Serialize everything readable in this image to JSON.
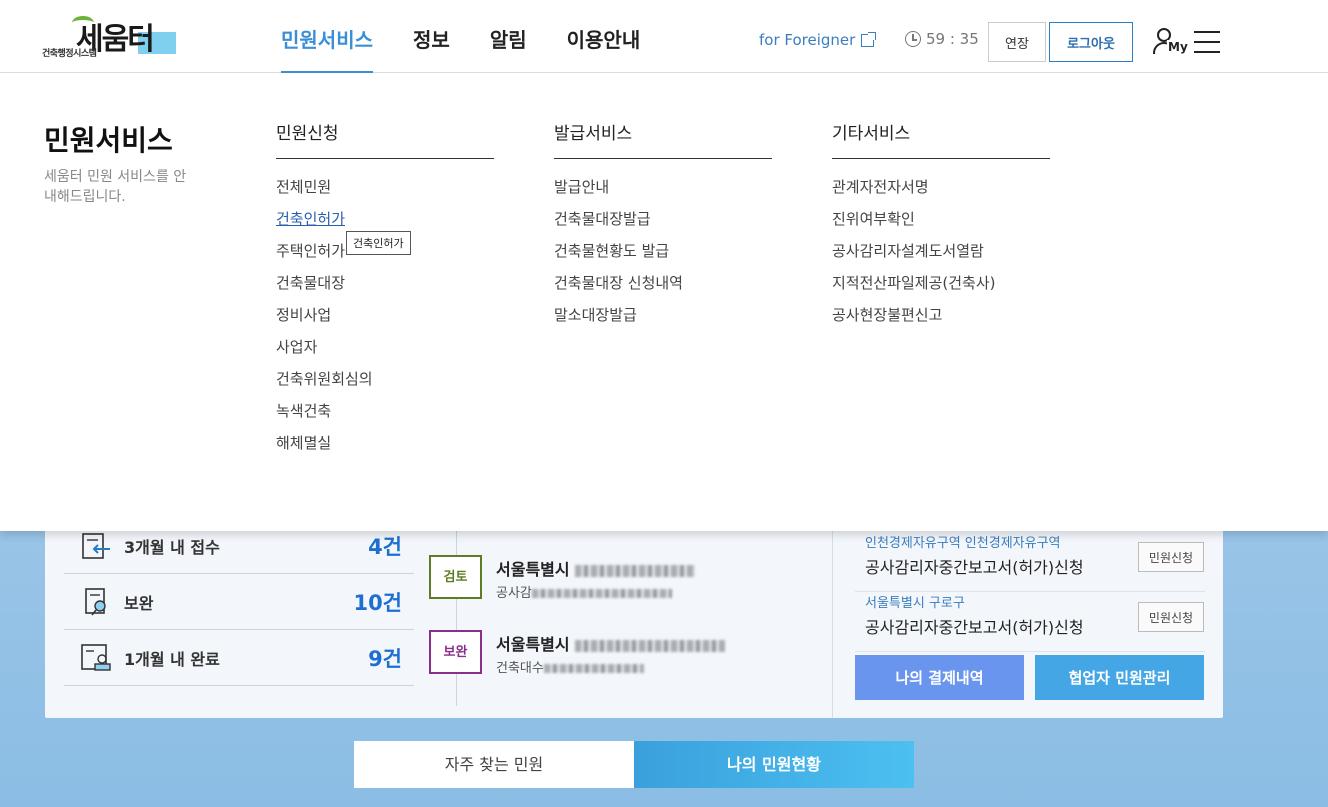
{
  "header": {
    "logo_main": "세움터",
    "logo_sub": "건축행정시스템",
    "nav": [
      "민원서비스",
      "정보",
      "알림",
      "이용안내"
    ],
    "foreigner_link": "for Foreigner",
    "timer": "59 : 35",
    "extend_label": "연장",
    "logout_label": "로그아웃",
    "my_label": "My"
  },
  "mega_menu": {
    "title": "민원서비스",
    "desc": "세움터 민원 서비스를 안내해드립니다.",
    "columns": [
      {
        "heading": "민원신청",
        "items": [
          "전체민원",
          "건축인허가",
          "주택인허가",
          "건축물대장",
          "정비사업",
          "사업자",
          "건축위원회심의",
          "녹색건축",
          "해체멸실"
        ]
      },
      {
        "heading": "발급서비스",
        "items": [
          "발급안내",
          "건축물대장발급",
          "건축물현황도 발급",
          "건축물대장 신청내역",
          "말소대장발급"
        ]
      },
      {
        "heading": "기타서비스",
        "items": [
          "관계자전자서명",
          "진위여부확인",
          "공사감리자설계도서열람",
          "지적전산파일제공(건축사)",
          "공사현장불편신고"
        ]
      }
    ],
    "tooltip": "건축인허가"
  },
  "stats": [
    {
      "label": "3개월 내 접수",
      "value": "4건",
      "icon": "document-arrow-icon"
    },
    {
      "label": "보완",
      "value": "10건",
      "icon": "document-search-icon"
    },
    {
      "label": "1개월 내 완료",
      "value": "9건",
      "icon": "document-stamp-icon"
    }
  ],
  "cases": [
    {
      "badge": "검토",
      "title_prefix": "서울특별시",
      "sub_prefix": "공사감"
    },
    {
      "badge": "보완",
      "title_prefix": "서울특별시",
      "sub_prefix": "건축대수"
    }
  ],
  "requests": [
    {
      "region": "인천경제자유구역 인천경제자유구역",
      "name": "공사감리자중간보고서(허가)신청",
      "button": "민원신청"
    },
    {
      "region": "서울특별시 구로구",
      "name": "공사감리자중간보고서(허가)신청",
      "button": "민원신청"
    }
  ],
  "actions": {
    "pay": "나의 결제내역",
    "coop": "협업자 민원관리"
  },
  "bottom_tabs": {
    "frequent": "자주 찾는 민원",
    "mine": "나의 민원현황"
  }
}
